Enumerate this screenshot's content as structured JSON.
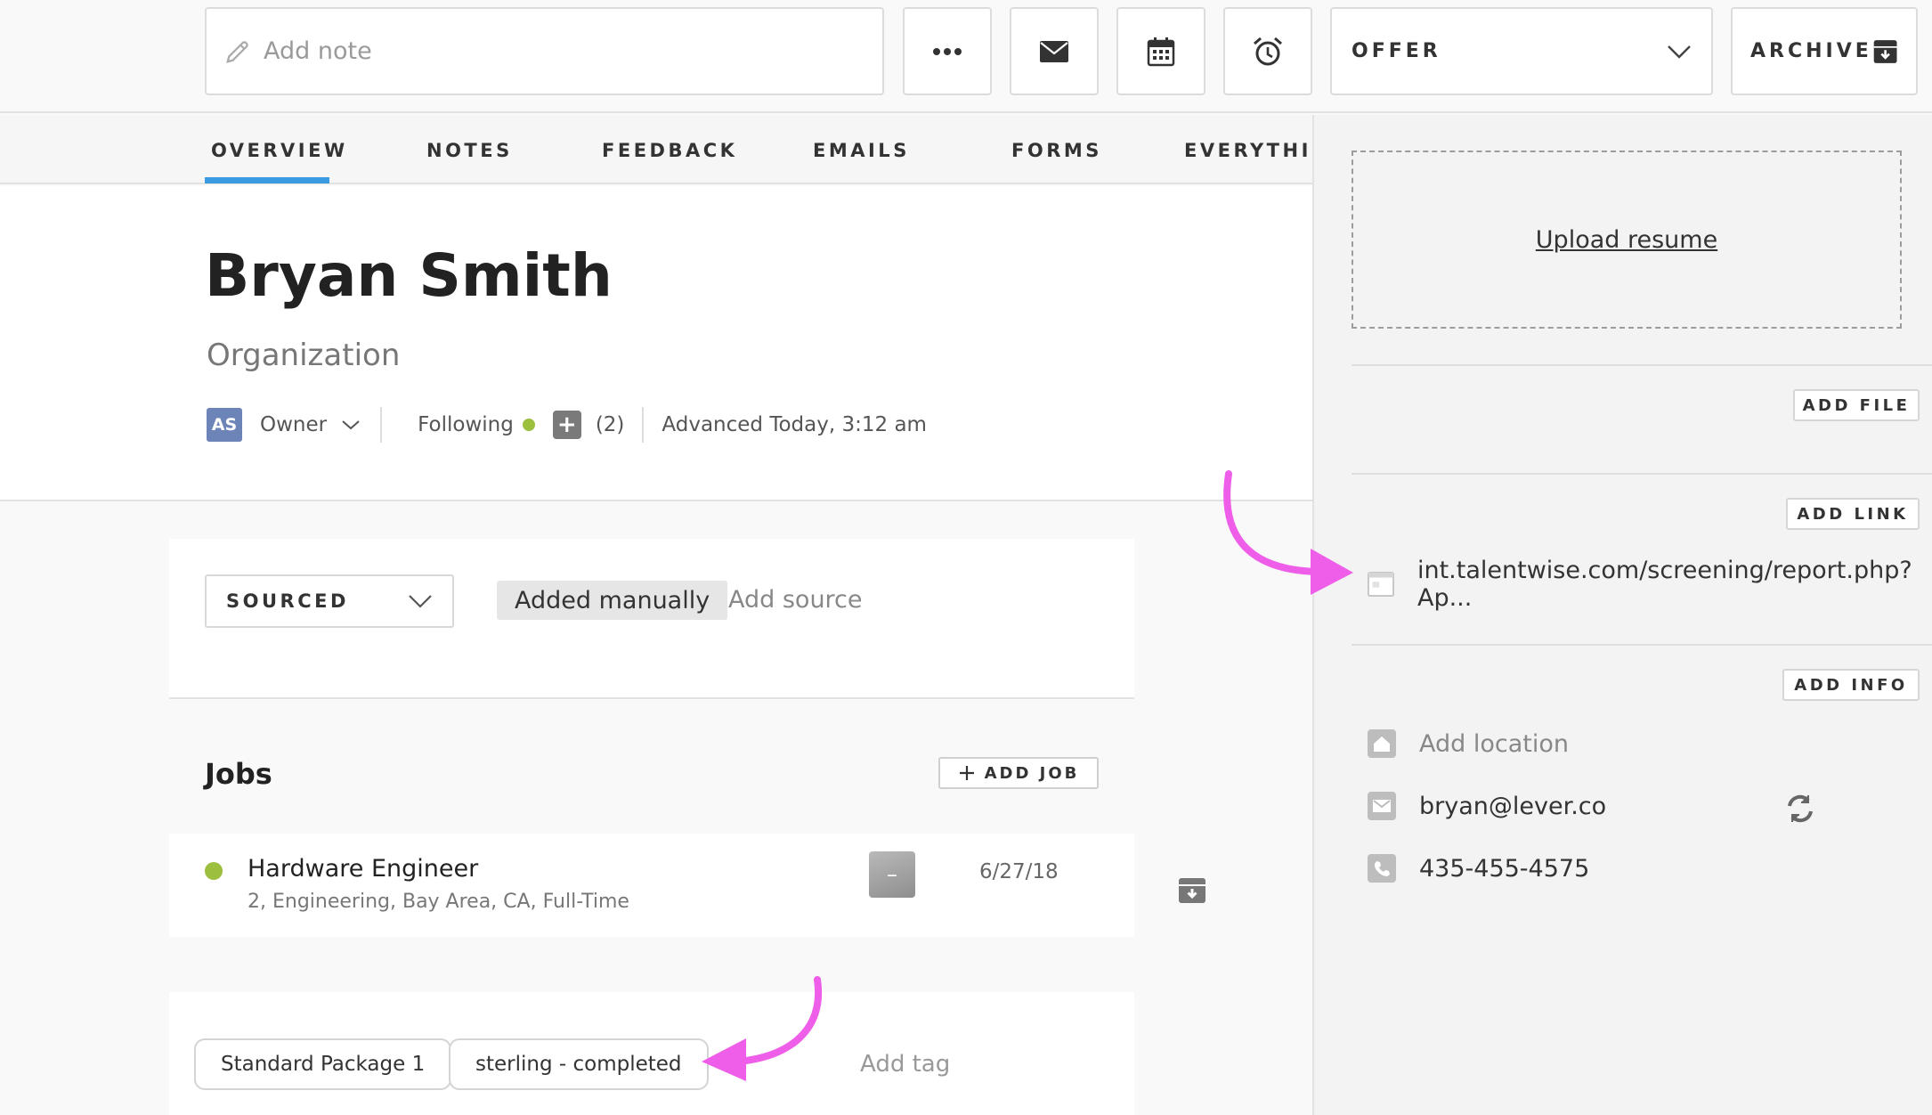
{
  "toolbar": {
    "note_placeholder": "Add note",
    "stage_label": "OFFER",
    "archive_label": "ARCHIVE"
  },
  "tabs": [
    "OVERVIEW",
    "NOTES",
    "FEEDBACK",
    "EMAILS",
    "FORMS",
    "EVERYTHING"
  ],
  "profile": {
    "name": "Bryan Smith",
    "organization": "Organization",
    "owner_initials": "AS",
    "owner_label": "Owner",
    "following_label": "Following",
    "followers_count": "(2)",
    "advanced": "Advanced Today, 3:12 am"
  },
  "source": {
    "origin": "SOURCED",
    "tag": "Added manually",
    "add_label": "Add source"
  },
  "jobs": {
    "title": "Jobs",
    "add_label": "ADD JOB",
    "items": [
      {
        "title": "Hardware Engineer",
        "subtitle": "2, Engineering, Bay Area, CA, Full-Time",
        "badge": "–",
        "date": "6/27/18"
      }
    ]
  },
  "tags": {
    "items": [
      "Standard Package 1",
      "sterling - completed"
    ],
    "add_label": "Add tag"
  },
  "sidebar": {
    "upload_label": "Upload resume",
    "add_file": "ADD FILE",
    "add_link": "ADD LINK",
    "link_url": "int.talentwise.com/screening/report.php?Ap...",
    "add_info": "ADD INFO",
    "location_placeholder": "Add location",
    "email": "bryan@lever.co",
    "phone": "435-455-4575"
  },
  "colors": {
    "accent": "#3a9be0",
    "status_green": "#9cbf3d",
    "annotation_arrow": "#ee5ee8"
  }
}
